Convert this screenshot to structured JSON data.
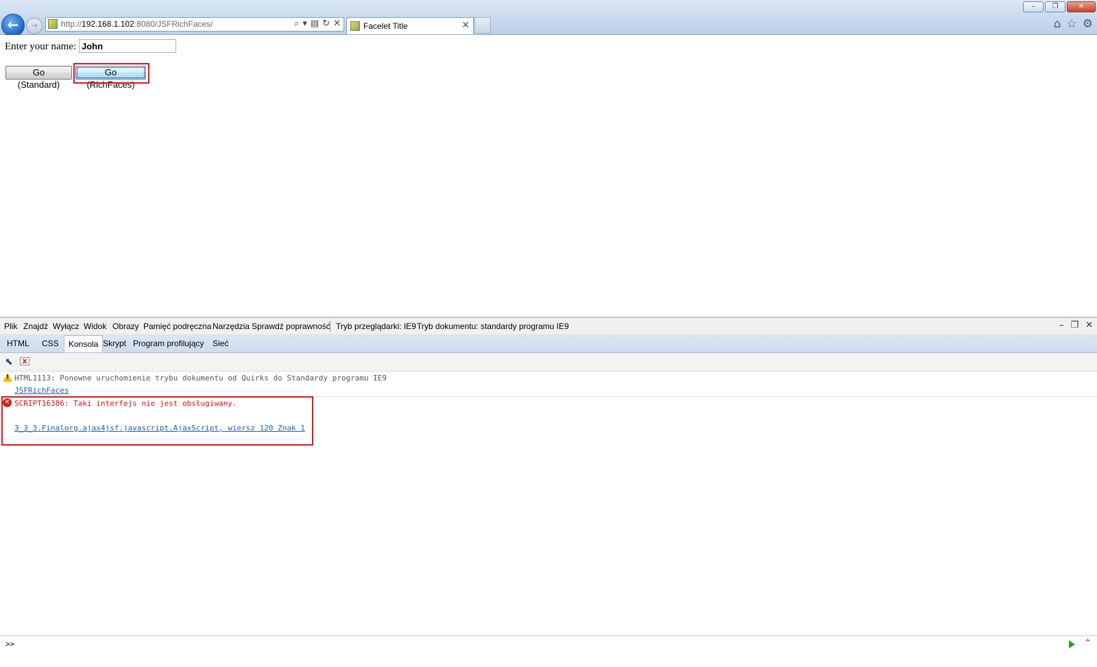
{
  "browser": {
    "url_prefix": "http://",
    "url_host": "192.168.1.102",
    "url_rest": ":8080/JSFRichFaces/",
    "tab_title": "Facelet Title"
  },
  "page": {
    "name_label": "Enter your name:",
    "name_value": "John",
    "button_standard": "Go (Standard)",
    "button_richfaces": "Go (RichFaces)"
  },
  "devtools": {
    "menu": [
      "Plik",
      "Znajdź",
      "Wyłącz",
      "Widok",
      "Obrazy",
      "Pamięć podręczna",
      "Narzędzia",
      "Sprawdź poprawność"
    ],
    "browser_mode_label": "Tryb przeglądarki:",
    "browser_mode_value": "IE9",
    "document_mode_label": "Tryb dokumentu:",
    "document_mode_value": "standardy programu IE9",
    "tabs": [
      "HTML",
      "CSS",
      "Konsola",
      "Skrypt",
      "Program profilujący",
      "Sieć"
    ],
    "active_tab": "Konsola",
    "console": {
      "warning_text": "HTML1113: Ponowne uruchomienie trybu dokumentu od Quirks do Standardy programu IE9",
      "warning_link": "JSFRichFaces",
      "error_text": "SCRIPT16386: Taki interfejs nie jest obsługiwany.",
      "error_link": "3_3_3.Finalorg.ajax4jsf.javascript.AjaxScript, wiersz 120 Znak 1"
    },
    "input_prompt": ">>"
  },
  "colors": {
    "highlight": "#e0121a",
    "error_text": "#e01010",
    "link": "#1c5fb7"
  }
}
